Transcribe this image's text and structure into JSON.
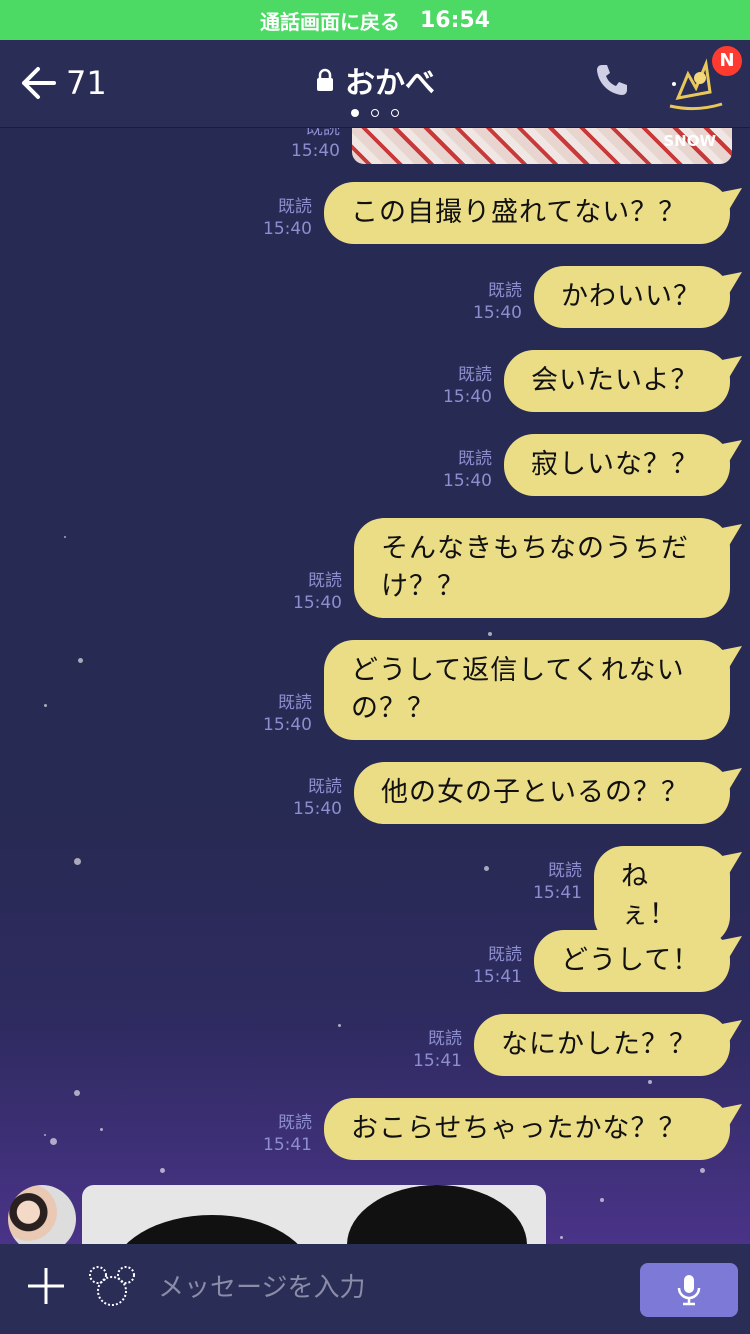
{
  "call_banner": {
    "label": "通話画面に戻る",
    "time": "16:54"
  },
  "header": {
    "back_count": "71",
    "title": "おかべ",
    "badge": "N",
    "page_indicator": {
      "current": 1,
      "total": 3
    }
  },
  "chat": {
    "top_image": {
      "watermark": "SNOW",
      "read": "既読",
      "time": "15:40"
    },
    "messages": [
      {
        "text": "この自撮り盛れてない？？",
        "read": "既読",
        "time": "15:40"
      },
      {
        "text": "かわいい？",
        "read": "既読",
        "time": "15:40"
      },
      {
        "text": "会いたいよ？",
        "read": "既読",
        "time": "15:40"
      },
      {
        "text": "寂しいな？？",
        "read": "既読",
        "time": "15:40"
      },
      {
        "text": "そんなきもちなのうちだけ？？",
        "read": "既読",
        "time": "15:40"
      },
      {
        "text": "どうして返信してくれないの？？",
        "read": "既読",
        "time": "15:40"
      },
      {
        "text": "他の女の子といるの？？",
        "read": "既読",
        "time": "15:40"
      },
      {
        "text": "ねぇ！",
        "read": "既読",
        "time": "15:41"
      },
      {
        "text": "どうして！",
        "read": "既読",
        "time": "15:41"
      },
      {
        "text": "なにかした？？",
        "read": "既読",
        "time": "15:41"
      },
      {
        "text": "おこらせちゃったかな？？",
        "read": "既読",
        "time": "15:41"
      }
    ]
  },
  "input": {
    "placeholder": "メッセージを入力"
  },
  "colors": {
    "call_banner": "#4cd964",
    "background": "#272a52",
    "bubble": "#ebdd86",
    "meta": "#8d8ecf",
    "mic_button": "#7d79d6",
    "badge": "#ff3b30"
  },
  "icons": [
    "back-arrow-icon",
    "lock-icon",
    "phone-icon",
    "plus-icon",
    "sticker-icon",
    "mic-icon"
  ]
}
